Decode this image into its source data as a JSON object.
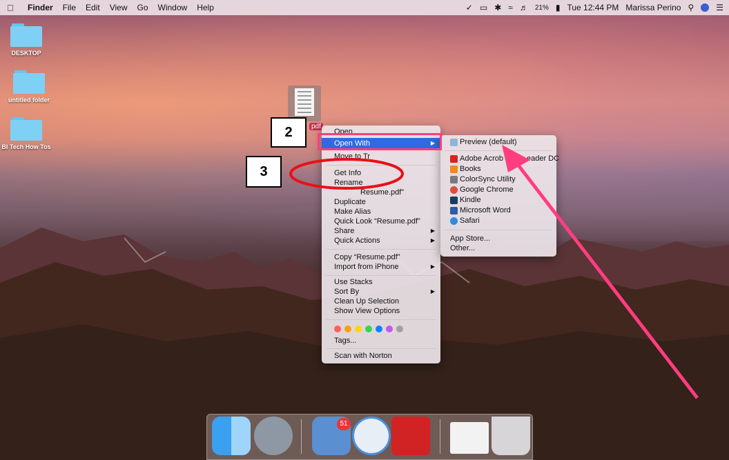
{
  "menubar": {
    "apple": "",
    "app": "Finder",
    "items": [
      "File",
      "Edit",
      "View",
      "Go",
      "Window",
      "Help"
    ],
    "battery": "21%",
    "clock": "Tue 12:44 PM",
    "user": "Marissa Perino"
  },
  "desktop": {
    "items": [
      {
        "label": "DESKTOP",
        "icon": "folder-icon"
      },
      {
        "label": "untitled folder",
        "icon": "folder-icon"
      },
      {
        "label": "BI Tech How Tos",
        "icon": "folder-icon"
      }
    ],
    "file_label": "pdf"
  },
  "context_menu": {
    "open": "Open",
    "open_with": "Open With",
    "move_to_trash": "Move to Tr",
    "get_info": "Get Info",
    "rename": "Rename",
    "compress": "Resume.pdf\"",
    "duplicate": "Duplicate",
    "make_alias": "Make Alias",
    "quick_look": "Quick Look “Resume.pdf”",
    "share": "Share",
    "quick_actions": "Quick Actions",
    "copy": "Copy “Resume.pdf”",
    "import_iphone": "Import from iPhone",
    "use_stacks": "Use Stacks",
    "sort_by": "Sort By",
    "clean_up": "Clean Up Selection",
    "show_view_options": "Show View Options",
    "tag_colors": [
      "#ff5f57",
      "#ff9f0a",
      "#ffd60a",
      "#32d74b",
      "#0a84ff",
      "#bf5af2",
      "#a0a0a0"
    ],
    "tags": "Tags...",
    "scan_norton": "Scan with Norton"
  },
  "open_with_menu": {
    "preview": "Preview (default)",
    "adobe_left": "Adobe Acrob",
    "adobe_right": "eader DC",
    "books": "Books",
    "colorsync": "ColorSync Utility",
    "chrome": "Google Chrome",
    "kindle": "Kindle",
    "word": "Microsoft Word",
    "safari": "Safari",
    "app_store": "App Store...",
    "other": "Other..."
  },
  "annotations": {
    "step2": "2",
    "step3": "3",
    "accent": "#ff3d7f",
    "circle_color": "#e8101a"
  },
  "dock": {
    "apps": [
      "finder-icon",
      "launchpad-icon",
      "mail-icon",
      "safari-icon",
      "acrobat-icon",
      "document-icon",
      "trash-icon"
    ],
    "mail_badge": "51"
  }
}
